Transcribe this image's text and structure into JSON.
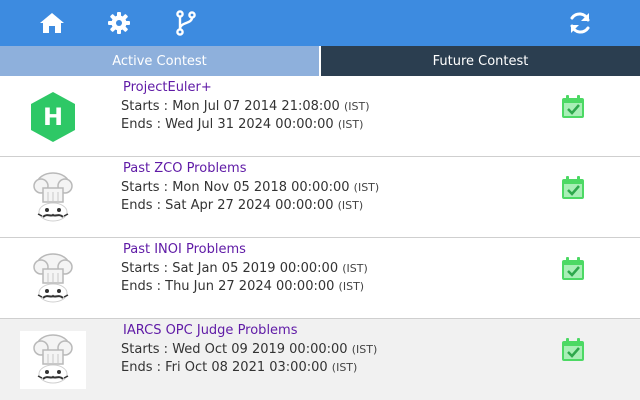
{
  "toolbar": {
    "icons": [
      "home-icon",
      "gear-icon",
      "git-branch-icon",
      "refresh-icon"
    ],
    "icon_color": "#ffffff",
    "bar_color": "#3d8be0"
  },
  "tabs": {
    "active_label": "Active Contest",
    "future_label": "Future Contest"
  },
  "contests": [
    {
      "name": "ProjectEuler+",
      "starts_label": "Starts : ",
      "starts": "Mon Jul 07 2014 21:08:00",
      "ends_label": "Ends : ",
      "ends": "Wed Jul 31 2024 00:00:00",
      "tz": "(IST)",
      "logo": "hackerrank-logo"
    },
    {
      "name": "Past ZCO Problems",
      "starts_label": "Starts : ",
      "starts": "Mon Nov 05 2018 00:00:00",
      "ends_label": "Ends : ",
      "ends": "Sat Apr 27 2024 00:00:00",
      "tz": "(IST)",
      "logo": "codechef-chef-logo"
    },
    {
      "name": "Past INOI Problems",
      "starts_label": "Starts : ",
      "starts": "Sat Jan 05 2019 00:00:00",
      "ends_label": "Ends : ",
      "ends": "Thu Jun 27 2024 00:00:00",
      "tz": "(IST)",
      "logo": "codechef-chef-logo"
    },
    {
      "name": "IARCS OPC Judge Problems",
      "starts_label": "Starts : ",
      "starts": "Wed Oct 09 2019 00:00:00",
      "ends_label": "Ends : ",
      "ends": "Fri Oct 08 2021 03:00:00",
      "tz": "(IST)",
      "logo": "codechef-chef-logo"
    }
  ],
  "colors": {
    "contest_name": "#5f1aa6",
    "calendar_icon": "#4cd964",
    "hackerrank_green": "#2ec866"
  }
}
